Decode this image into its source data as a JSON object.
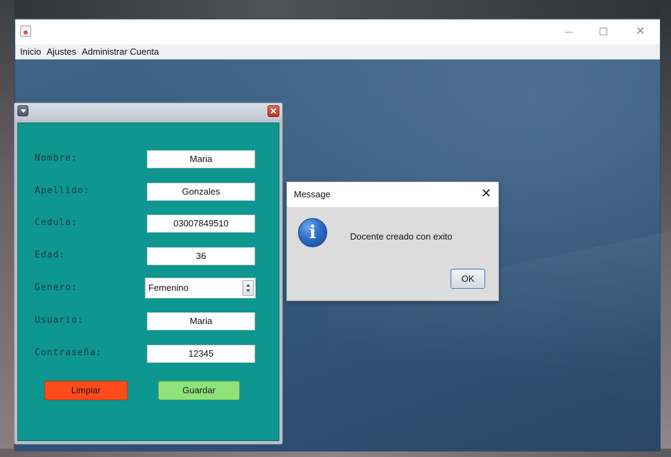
{
  "menu": {
    "items": [
      "Inicio",
      "Ajustes",
      "Administrar Cuenta"
    ]
  },
  "window_controls": {
    "minimize": "—",
    "maximize": "□",
    "close": "✕"
  },
  "form": {
    "close_glyph": "✕",
    "fields": {
      "nombre": {
        "label": "Nombre:",
        "value": "Maria"
      },
      "apellido": {
        "label": "Apellido:",
        "value": "Gonzales"
      },
      "cedula": {
        "label": "Cedula:",
        "value": "03007849510"
      },
      "edad": {
        "label": "Edad:",
        "value": "36"
      },
      "genero": {
        "label": "Genero:",
        "value": "Femenino"
      },
      "usuario": {
        "label": "Usuario:",
        "value": "Maria"
      },
      "contrasena": {
        "label": "Contraseña:",
        "value": "12345"
      }
    },
    "buttons": {
      "limpiar": "Limpiar",
      "guardar": "Guardar"
    },
    "colors": {
      "panel": "#0e9690",
      "limpiar": "#ff4a1a",
      "guardar": "#8fe37a"
    }
  },
  "dialog": {
    "title": "Message",
    "close_glyph": "✕",
    "icon_glyph": "i",
    "message": "Docente creado con exito",
    "ok_label": "OK"
  }
}
